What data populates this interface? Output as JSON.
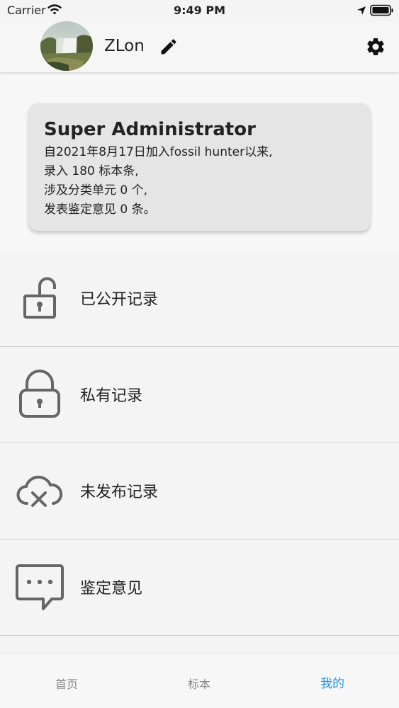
{
  "status_bar": {
    "carrier": "Carrier",
    "time": "9:49 PM"
  },
  "header": {
    "username": "ZLon",
    "icons": [
      "avatar",
      "edit-icon",
      "settings-icon"
    ]
  },
  "profile_card": {
    "title": "Super Administrator",
    "lines": [
      "自2021年8月17日加入fossil hunter以来,",
      "录入 180 标本条,",
      "涉及分类单元 0 个,",
      "发表鉴定意见 0 条。"
    ]
  },
  "menu": [
    {
      "label": "已公开记录",
      "icon": "unlock-icon"
    },
    {
      "label": "私有记录",
      "icon": "lock-icon"
    },
    {
      "label": "未发布记录",
      "icon": "cloud-cancel-icon"
    },
    {
      "label": "鉴定意见",
      "icon": "comment-icon"
    }
  ],
  "tabs": {
    "home": "首页",
    "specimen": "标本",
    "mine": "我的",
    "active": "mine",
    "active_color": "#2196f3"
  }
}
